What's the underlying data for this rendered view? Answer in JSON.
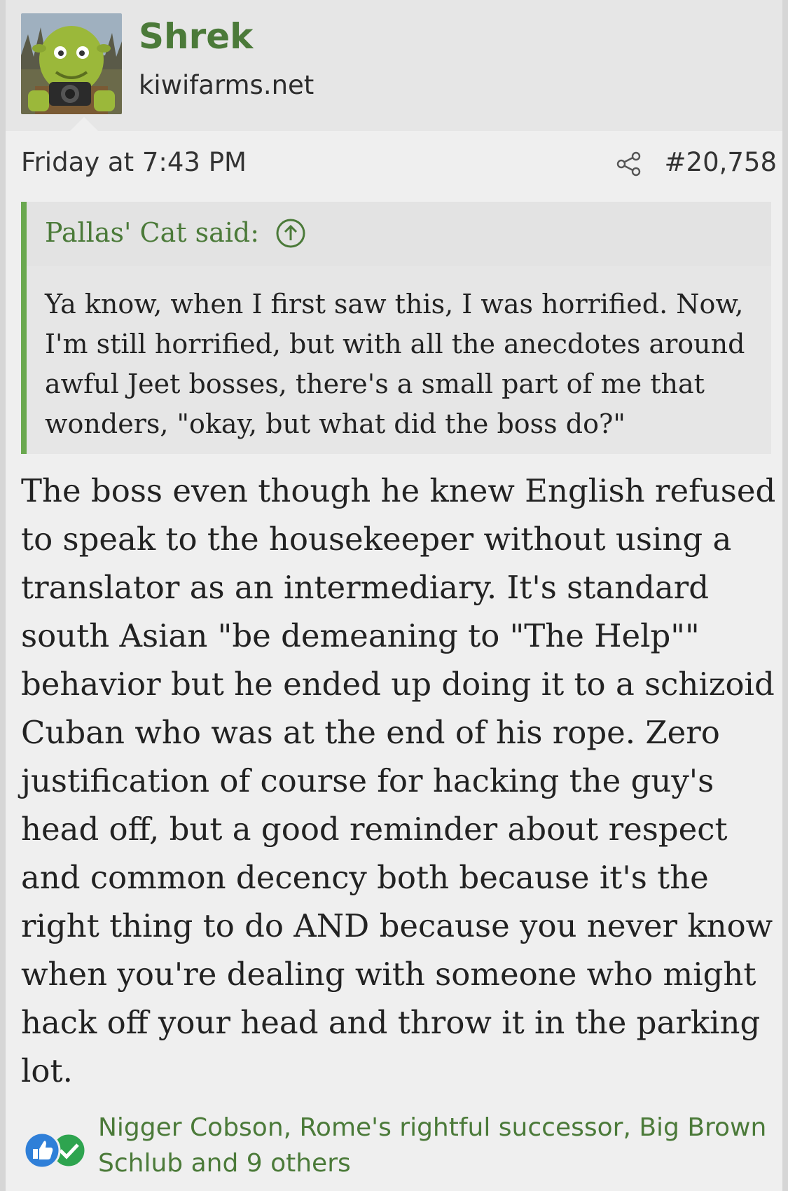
{
  "post": {
    "username": "Shrek",
    "site": "kiwifarms.net",
    "date": "Friday at 7:43 PM",
    "post_number": "#20,758",
    "quote": {
      "author": "Pallas' Cat said:",
      "text": "Ya know, when I first saw this, I was horrified. Now, I'm still horrified, but with all the anecdotes around awful Jeet bosses, there's a small part of me that wonders, \"okay, but what did the boss do?\""
    },
    "body": "The boss even though he knew English refused to speak to the housekeeper without using a translator as an intermediary. It's standard south Asian \"be demeaning to \"The Help\"\" behavior but he ended up doing it to a schizoid Cuban who was at the end of his rope. Zero justification of course for hacking the guy's head off, but a good reminder about respect and common decency both because it's the right thing to do AND because you never know when you're dealing with someone who might hack off your head and throw it in the parking lot.",
    "reactions": {
      "name_1": "Nigger Cobson",
      "sep_1": ", ",
      "name_2": "Rome's rightful successor",
      "sep_2": ", ",
      "name_3": "Big Brown Schlub",
      "suffix": " and 9 others"
    }
  },
  "colors": {
    "accent_green": "#4b7a39",
    "quote_bar": "#6aa84f",
    "like_blue": "#2f7fd8",
    "agree_green": "#2ea44f"
  },
  "icons": [
    "share-icon",
    "jump-to-quote-icon",
    "like-icon",
    "agree-icon"
  ]
}
